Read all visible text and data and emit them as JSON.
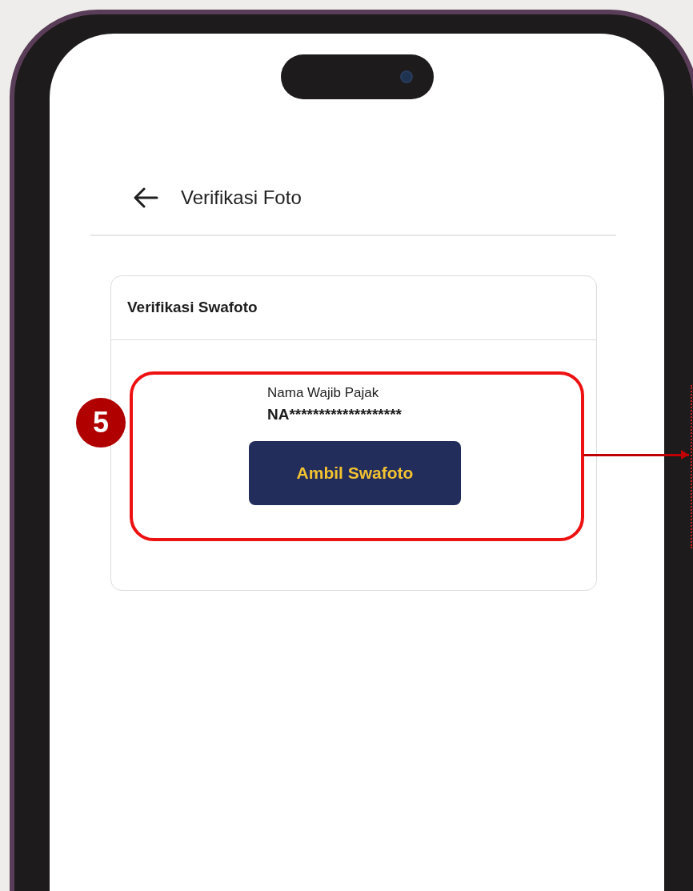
{
  "header": {
    "title": "Verifikasi Foto"
  },
  "card": {
    "title": "Verifikasi Swafoto",
    "field_label": "Nama Wajib Pajak",
    "field_value": "NA*******************",
    "button": "Ambil Swafoto"
  },
  "annotation": {
    "number": "5"
  }
}
